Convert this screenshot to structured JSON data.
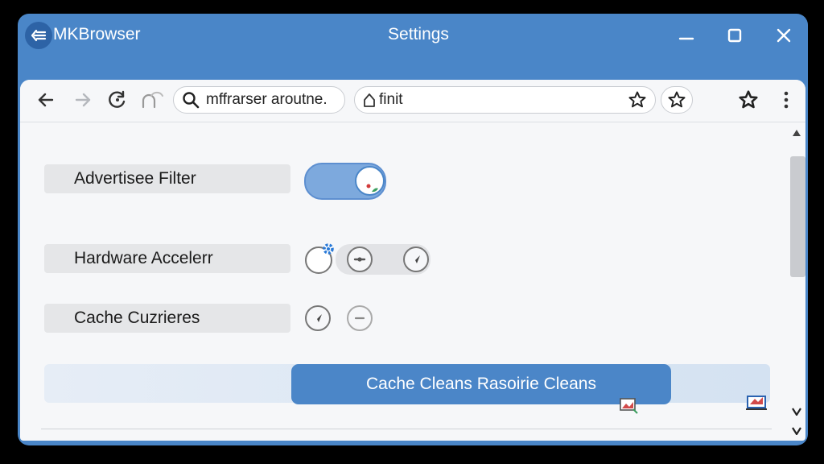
{
  "window": {
    "app_name": "MKBrowser",
    "title": "Settings"
  },
  "toolbar": {
    "search_text": "mffrarser aroutne.",
    "address_text": "finit"
  },
  "settings": {
    "items": [
      {
        "label": "Advertisee Filter",
        "enabled": true
      },
      {
        "label": "Hardware Accelerr"
      },
      {
        "label": "Cache Cuzrieres"
      }
    ],
    "clean_button_label": "Cache Cleans Rasoirie Cleans"
  },
  "colors": {
    "accent": "#4a86c8",
    "toggle_track": "#7da9dd",
    "background": "#f6f7f9"
  }
}
